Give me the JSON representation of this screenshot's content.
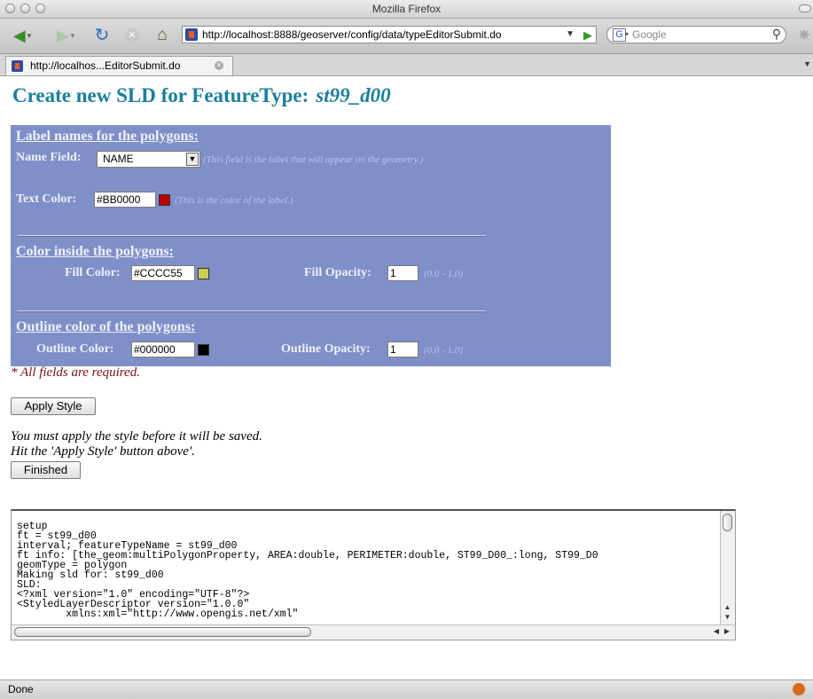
{
  "window": {
    "title": "Mozilla Firefox"
  },
  "toolbar": {
    "url": "http://localhost:8888/geoserver/config/data/typeEditorSubmit.do",
    "search_placeholder": "Google"
  },
  "tab": {
    "label": "http://localhos...EditorSubmit.do"
  },
  "page": {
    "heading": "Create new SLD for FeatureType:",
    "feature_type": "st99_d00",
    "label_section": {
      "title": "Label names for the polygons:",
      "name_field_label": "Name Field:",
      "name_field_value": "NAME",
      "name_field_hint": "(This field is the label that will appear on the geometry.)",
      "text_color_label": "Text Color:",
      "text_color_value": "#BB0000",
      "text_color_hint": "(This is the color of the label.)"
    },
    "fill_section": {
      "title": "Color inside the polygons:",
      "fill_color_label": "Fill Color:",
      "fill_color_value": "#CCCC55",
      "fill_opacity_label": "Fill Opacity:",
      "fill_opacity_value": "1",
      "fill_opacity_hint": "(0.0 - 1.0)"
    },
    "outline_section": {
      "title": "Outline color of the polygons:",
      "outline_color_label": "Outline Color:",
      "outline_color_value": "#000000",
      "outline_opacity_label": "Outline Opacity:",
      "outline_opacity_value": "1",
      "outline_opacity_hint": "(0.0 - 1.0)"
    },
    "required_note": "* All fields are required.",
    "apply_button": "Apply Style",
    "apply_note_line1": "You must apply the style before it will be saved.",
    "apply_note_line2": "Hit the 'Apply Style' button above'.",
    "finished_button": "Finished",
    "log_text": "setup\nft = st99_d00\ninterval; featureTypeName = st99_d00\nft info: [the_geom:multiPolygonProperty, AREA:double, PERIMETER:double, ST99_D00_:long, ST99_D0\ngeomType = polygon\nMaking sld for: st99_d00\nSLD:\n<?xml version=\"1.0\" encoding=\"UTF-8\"?>\n<StyledLayerDescriptor version=\"1.0.0\"\n        xmlns:xml=\"http://www.opengis.net/xml\""
  },
  "status": {
    "text": "Done"
  },
  "colors": {
    "heading": "#1a7f9c",
    "panel_bg": "#7f8fc7",
    "text_color_swatch": "#BB0000",
    "fill_color_swatch": "#CCCC55",
    "outline_color_swatch": "#000000",
    "required_note": "#7a1111"
  },
  "icons": [
    "back-icon",
    "forward-icon",
    "reload-icon",
    "stop-icon",
    "home-icon",
    "go-icon",
    "search-icon",
    "tab-close-icon",
    "firebug-icon"
  ]
}
